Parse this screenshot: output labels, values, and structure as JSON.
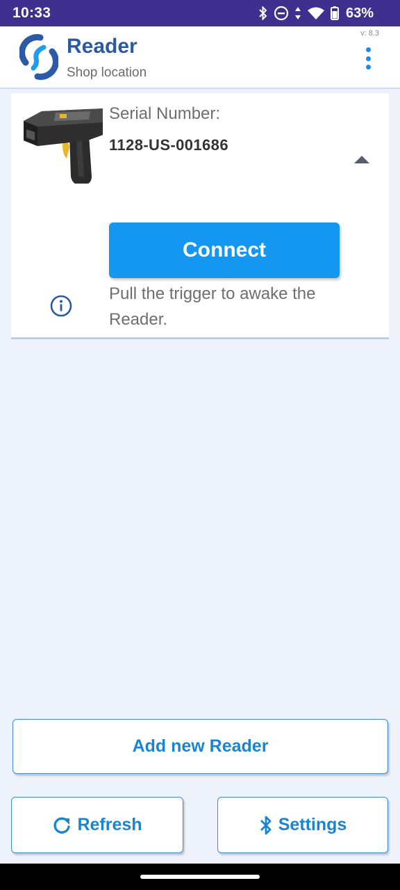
{
  "status_bar": {
    "time": "10:33",
    "battery": "63%",
    "icons": [
      "bluetooth-icon",
      "do-not-disturb-icon",
      "data-arrows-icon",
      "wifi-icon",
      "battery-icon"
    ]
  },
  "app_bar": {
    "title": "Reader",
    "subtitle": "Shop location",
    "version": "v: 8.3",
    "menu_icon": "more-vert-icon"
  },
  "reader_card": {
    "serial_label": "Serial Number:",
    "serial_value": "1128-US-001686",
    "connect_label": "Connect",
    "hint": "Pull the trigger to awake the Reader.",
    "image": "rfid-reader-image",
    "expanded": true
  },
  "actions": {
    "add_reader_label": "Add new Reader",
    "refresh_label": "Refresh",
    "settings_label": "Settings"
  },
  "colors": {
    "status_bar": "#3f2f8f",
    "title_blue": "#2c5aa0",
    "accent_blue": "#1497f0",
    "outline_blue": "#1a85cf",
    "background": "#eef2fb"
  }
}
